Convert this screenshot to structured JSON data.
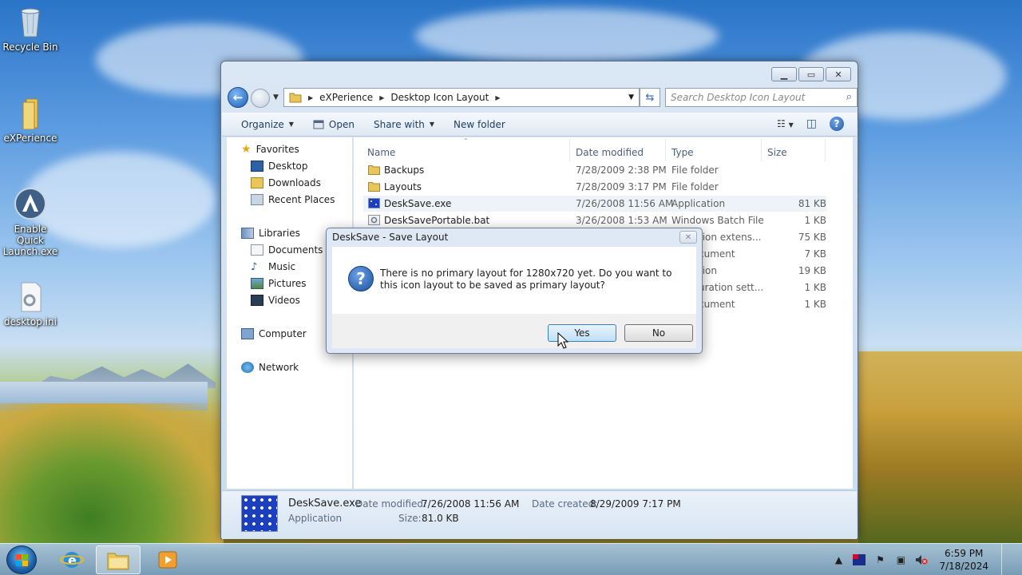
{
  "desktop": {
    "icons": [
      {
        "label": "Recycle Bin",
        "icon": "recycle-bin-icon"
      },
      {
        "label": "eXPerience",
        "icon": "folder-icon"
      },
      {
        "label": "Enable Quick Launch.exe",
        "icon": "app-icon"
      },
      {
        "label": "desktop.ini",
        "icon": "settings-file-icon"
      }
    ]
  },
  "explorer": {
    "breadcrumb": [
      "eXPerience",
      "Desktop Icon Layout"
    ],
    "search_placeholder": "Search Desktop Icon Layout",
    "toolbar": {
      "organize": "Organize",
      "open": "Open",
      "share_with": "Share with",
      "new_folder": "New folder"
    },
    "nav": {
      "favorites": "Favorites",
      "desktop": "Desktop",
      "downloads": "Downloads",
      "recent_places": "Recent Places",
      "libraries": "Libraries",
      "documents": "Documents",
      "music": "Music",
      "pictures": "Pictures",
      "videos": "Videos",
      "computer": "Computer",
      "network": "Network"
    },
    "columns": {
      "name": "Name",
      "date_modified": "Date modified",
      "type": "Type",
      "size": "Size"
    },
    "files": [
      {
        "name": "Backups",
        "date": "7/28/2009 2:38 PM",
        "type": "File folder",
        "size": "",
        "icon": "folder-icon"
      },
      {
        "name": "Layouts",
        "date": "7/28/2009 3:17 PM",
        "type": "File folder",
        "size": "",
        "icon": "folder-icon"
      },
      {
        "name": "DeskSave.exe",
        "date": "7/26/2008 11:56 AM",
        "type": "Application",
        "size": "81 KB",
        "icon": "app-icon"
      },
      {
        "name": "DeskSavePortable.bat",
        "date": "3/26/2008 1:53 AM",
        "type": "Windows Batch File",
        "size": "1 KB",
        "icon": "batch-icon"
      },
      {
        "name": "",
        "date": "",
        "type": "tion extens...",
        "size": "75 KB",
        "icon": ""
      },
      {
        "name": "",
        "date": "",
        "type": "cument",
        "size": "7 KB",
        "icon": ""
      },
      {
        "name": "",
        "date": "",
        "type": "tion",
        "size": "19 KB",
        "icon": ""
      },
      {
        "name": "",
        "date": "",
        "type": "uration sett...",
        "size": "1 KB",
        "icon": ""
      },
      {
        "name": "",
        "date": "",
        "type": "cument",
        "size": "1 KB",
        "icon": ""
      }
    ],
    "details": {
      "name": "DeskSave.exe",
      "type": "Application",
      "date_modified_label": "Date modified:",
      "date_modified": "7/26/2008 11:56 AM",
      "date_created_label": "Date created:",
      "date_created": "8/29/2009 7:17 PM",
      "size_label": "Size:",
      "size": "81.0 KB"
    }
  },
  "dialog": {
    "title": "DeskSave - Save Layout",
    "message": "There is no primary layout for 1280x720 yet. Do you want to this icon layout to be saved as primary layout?",
    "yes": "Yes",
    "no": "No"
  },
  "taskbar": {
    "time": "6:59 PM",
    "date": "7/18/2024"
  }
}
